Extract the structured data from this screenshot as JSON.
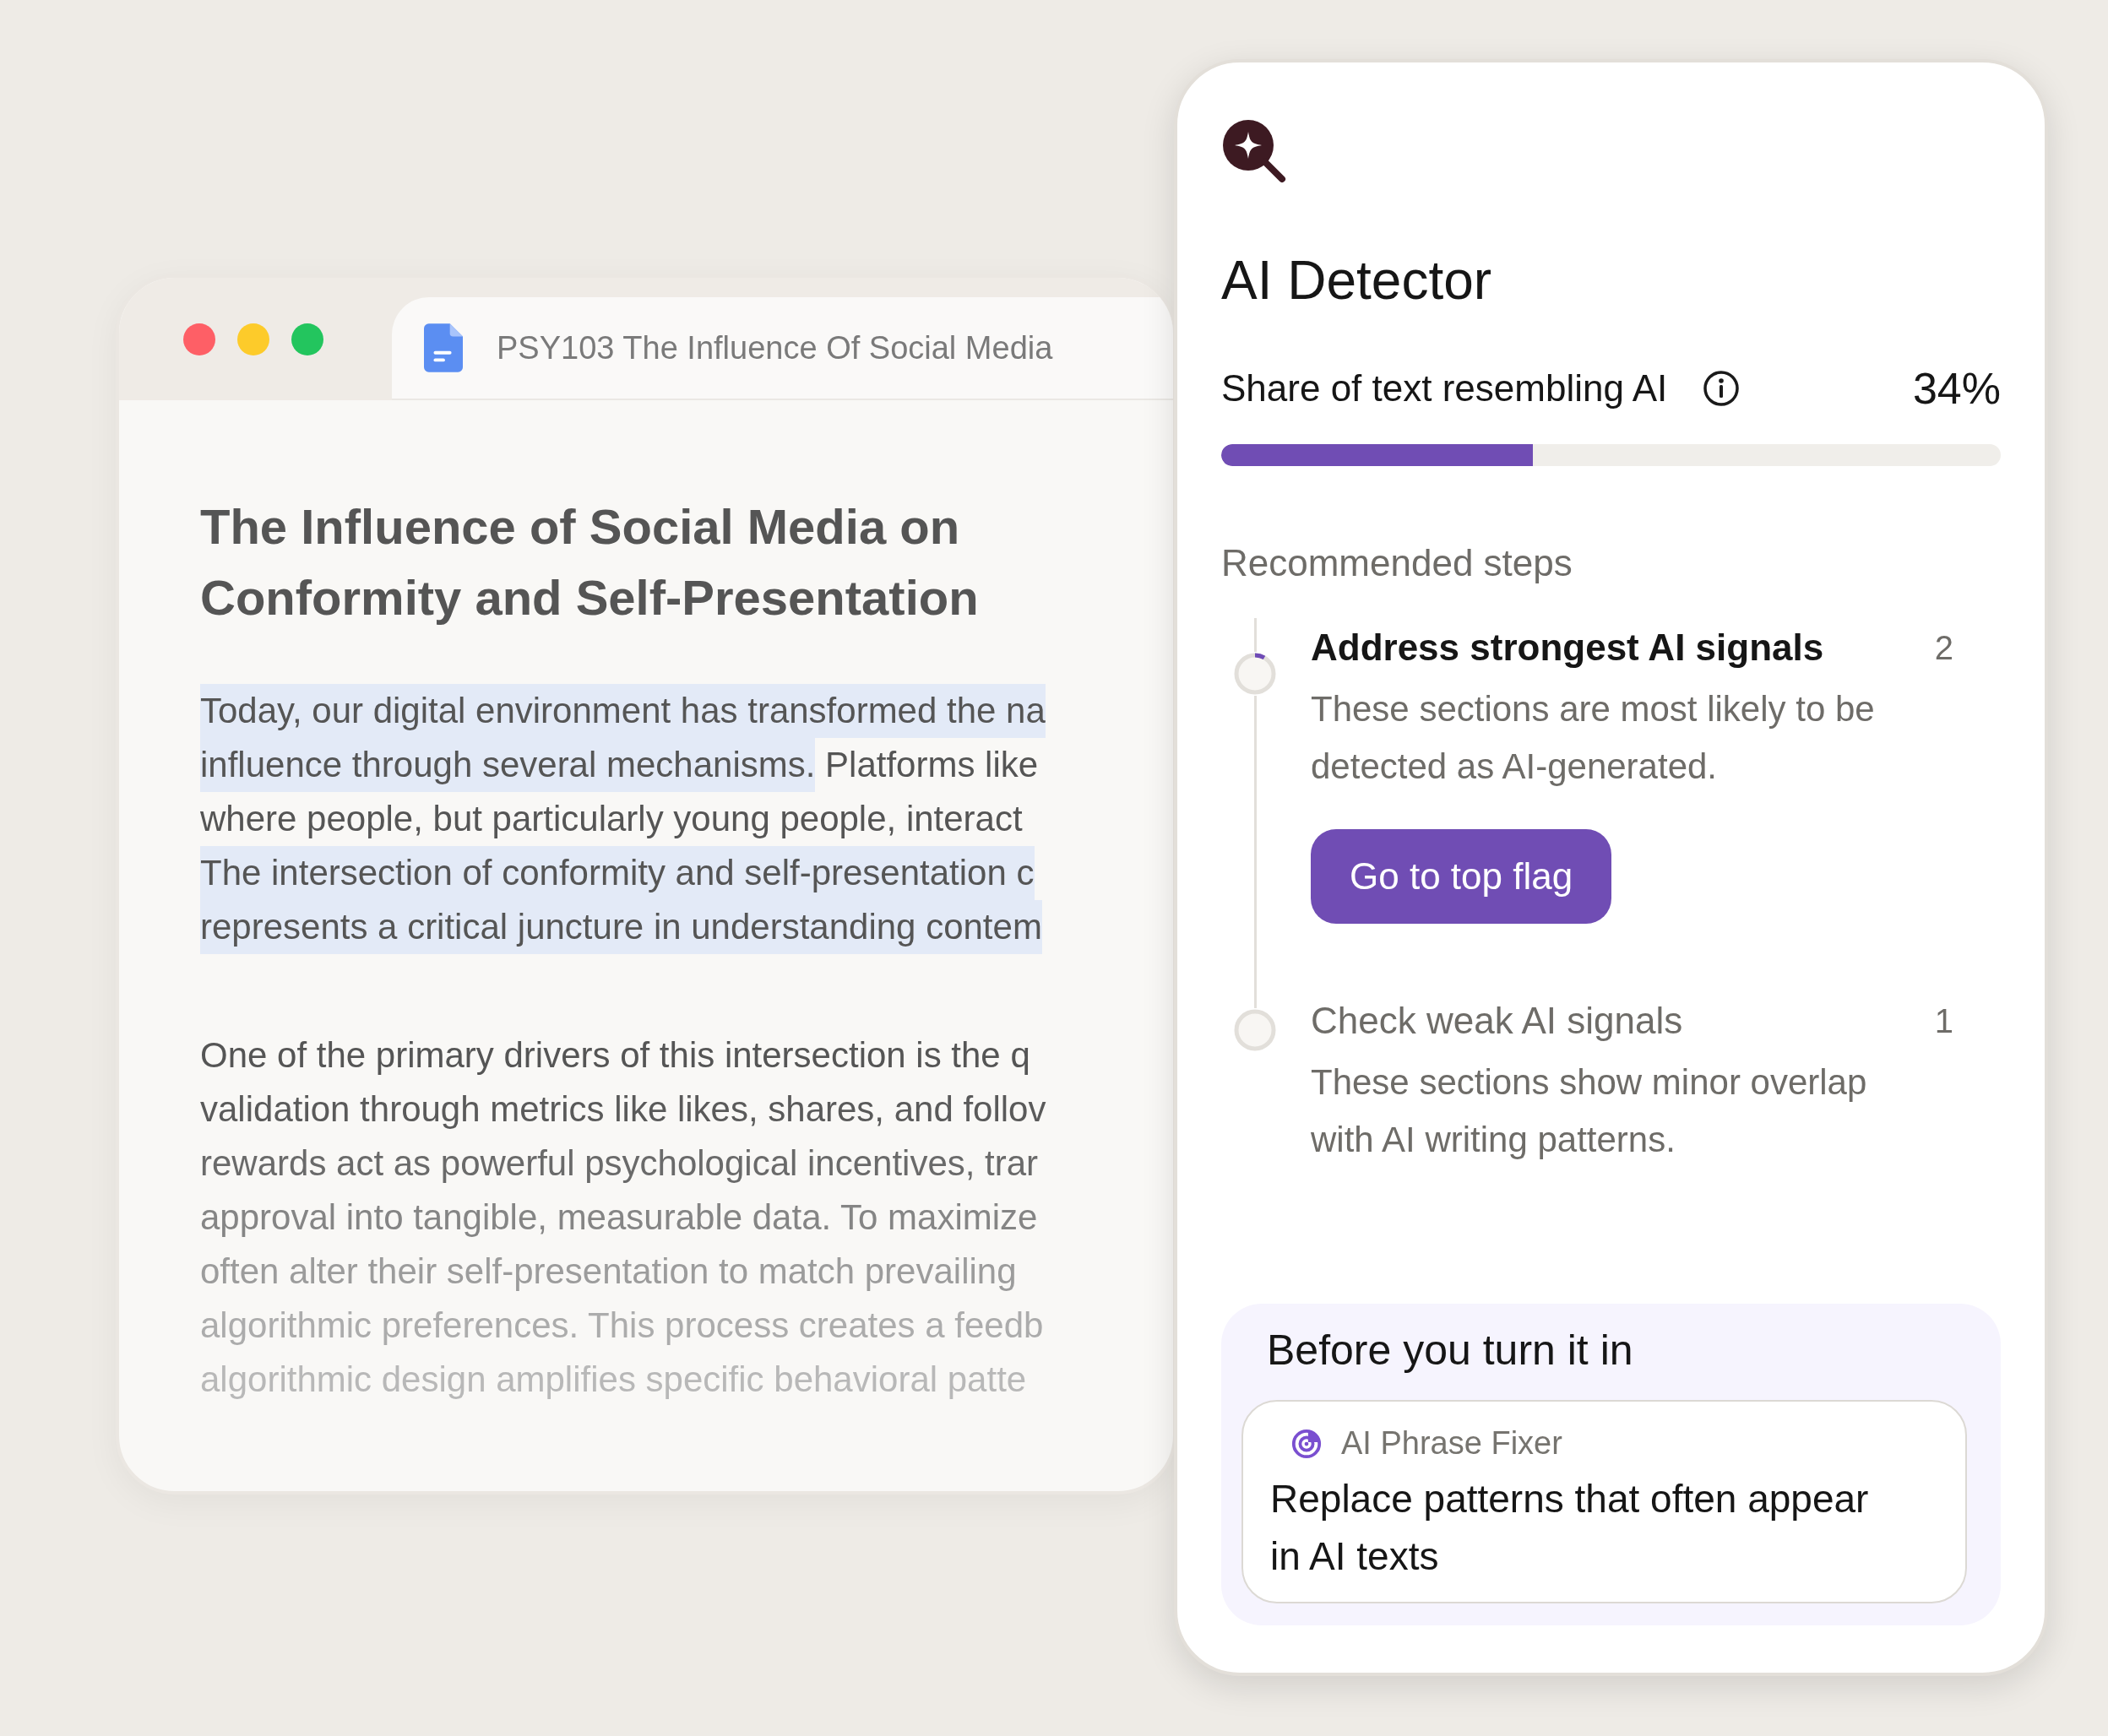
{
  "document_window": {
    "traffic_lights": [
      {
        "color": "#fe5f66"
      },
      {
        "color": "#fdcb2a"
      },
      {
        "color": "#23c55e"
      }
    ],
    "tab": {
      "title": "PSY103 The Influence Of Social Media"
    },
    "heading": "The Influence of Social Media on Conformity and Self-Presentation",
    "paragraphs": [
      {
        "lines": [
          [
            {
              "text": "Today, our digital environment has transformed the na",
              "highlighted": true
            }
          ],
          [
            {
              "text": "influence through several mechanisms.",
              "highlighted": true
            },
            {
              "text": " Platforms like",
              "highlighted": false
            }
          ],
          [
            {
              "text": "where people, but particularly young people, interact",
              "highlighted": false
            }
          ],
          [
            {
              "text": "The intersection of conformity and self-presentation c",
              "highlighted": true
            }
          ],
          [
            {
              "text": "represents a critical juncture in understanding contem",
              "highlighted": true
            }
          ]
        ]
      },
      {
        "lines": [
          [
            {
              "text": "One of the primary drivers of this intersection is the q",
              "highlighted": false
            }
          ],
          [
            {
              "text": "validation through metrics like likes, shares, and follov",
              "highlighted": false
            }
          ],
          [
            {
              "text": "rewards act as powerful psychological incentives, trar",
              "highlighted": false
            }
          ],
          [
            {
              "text": "approval into tangible, measurable data. To maximize",
              "highlighted": false
            }
          ],
          [
            {
              "text": "often alter their self-presentation to match prevailing",
              "highlighted": false
            }
          ],
          [
            {
              "text": "algorithmic preferences. This process creates a feedb",
              "highlighted": false
            }
          ],
          [
            {
              "text": "algorithmic design amplifies specific behavioral patte",
              "highlighted": false
            }
          ]
        ]
      }
    ]
  },
  "detector_panel": {
    "title": "AI Detector",
    "score": {
      "label": "Share of text resembling AI",
      "value": "34%",
      "level": 0.4
    },
    "steps_heading": "Recommended steps",
    "steps": [
      {
        "title": "Address strongest AI signals",
        "count": "2",
        "description": "These sections are most likely to be detected as AI-generated.",
        "active": true,
        "button": "Go to top flag"
      },
      {
        "title": "Check weak AI signals",
        "count": "1",
        "description": "These sections show minor overlap with AI writing patterns.",
        "active": false
      }
    ],
    "checklist": {
      "heading": "Before you turn it in",
      "tools": [
        {
          "name": "AI Phrase Fixer",
          "description": "Replace patterns that often appear in AI texts"
        }
      ]
    }
  }
}
